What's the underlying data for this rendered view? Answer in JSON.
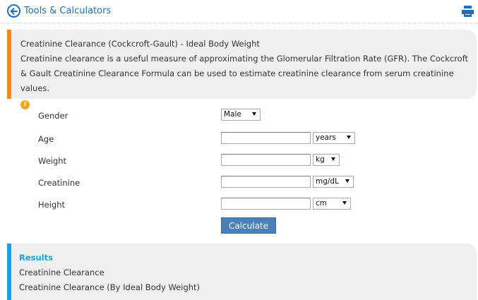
{
  "header": {
    "back_label": "Tools & Calculators"
  },
  "info": {
    "title": "Creatinine Clearance (Cockcroft-Gault) - Ideal Body Weight",
    "description": "Creatinine clearance is a useful measure of approximating the Glomerular Filtration Rate (GFR). The Cockcroft & Gault Creatinine Clearance Formula can be used to estimate creatinine clearance from serum creatinine values.",
    "info_icon": "i"
  },
  "form": {
    "gender": {
      "label": "Gender",
      "value": "Male"
    },
    "age": {
      "label": "Age",
      "value": "",
      "unit": "years"
    },
    "weight": {
      "label": "Weight",
      "value": "",
      "unit": "kg"
    },
    "creatinine": {
      "label": "Creatinine",
      "value": "",
      "unit": "mg/dL"
    },
    "height": {
      "label": "Height",
      "value": "",
      "unit": "cm"
    },
    "calculate_label": "Calculate"
  },
  "results": {
    "title": "Results",
    "items": [
      "Creatinine Clearance",
      "Creatinine Clearance (By Ideal Body Weight)"
    ]
  },
  "colors": {
    "link_blue": "#1f6fb8",
    "info_accent": "#f08a1a",
    "results_accent": "#1aa3dc",
    "button": "#4a80b8"
  },
  "icons": [
    "back-arrow-icon",
    "print-icon",
    "info-icon",
    "chevron-down-icon"
  ]
}
